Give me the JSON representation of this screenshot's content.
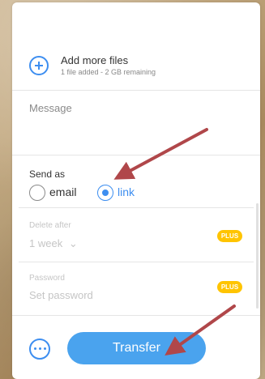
{
  "add_files": {
    "title": "Add more files",
    "subtitle": "1 file added - 2 GB remaining"
  },
  "message": {
    "placeholder": "Message"
  },
  "send_as": {
    "label": "Send as",
    "options": [
      {
        "label": "email",
        "selected": false
      },
      {
        "label": "link",
        "selected": true
      }
    ]
  },
  "delete_after": {
    "label": "Delete after",
    "value": "1 week",
    "badge": "PLUS"
  },
  "password": {
    "label": "Password",
    "placeholder": "Set password",
    "badge": "PLUS"
  },
  "footer": {
    "transfer_label": "Transfer"
  },
  "colors": {
    "accent": "#3d8ef0",
    "transfer_bg": "#4aa3ee",
    "plus_badge": "#ffc400",
    "annotation_arrow": "#b0474a"
  }
}
